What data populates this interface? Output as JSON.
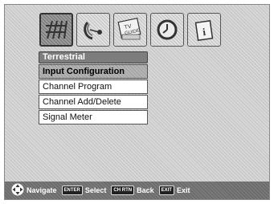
{
  "menu_bar": {
    "icons": [
      "antenna-icon",
      "satellite-dish-icon",
      "tv-guide-icon",
      "clock-icon",
      "info-icon"
    ],
    "selected_index": 0,
    "tv_guide_text": [
      "TV",
      "GUIDE"
    ],
    "info_glyph": "i"
  },
  "submenu": {
    "title": "Terrestrial",
    "items": [
      {
        "label": "Input Configuration",
        "selected": true
      },
      {
        "label": "Channel Program",
        "selected": false
      },
      {
        "label": "Channel Add/Delete",
        "selected": false
      },
      {
        "label": "Signal Meter",
        "selected": false
      }
    ]
  },
  "footer": {
    "navigate": "Navigate",
    "enter_key": "ENTER",
    "select": "Select",
    "ch_rtn_key": "CH RTN",
    "back": "Back",
    "exit_key": "EXIT",
    "exit": "Exit"
  },
  "colors": {
    "selected_tile": "#9c9c9c",
    "menu_header": "#7d7d7d",
    "bottom_bar": "#7a7a7a"
  }
}
